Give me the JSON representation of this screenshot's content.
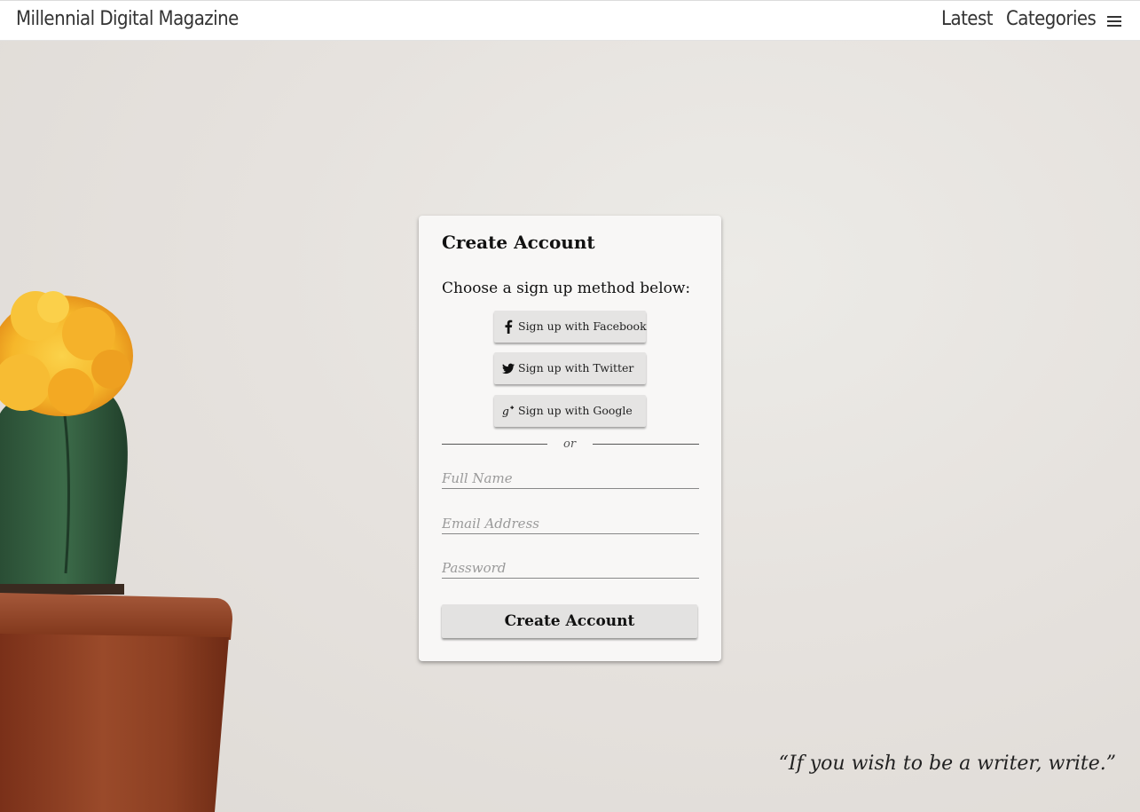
{
  "header": {
    "brand": "Millennial Digital Magazine",
    "nav": {
      "latest": "Latest",
      "categories": "Categories"
    },
    "menu_icon": "hamburger-menu-icon"
  },
  "card": {
    "title": "Create Account",
    "subtitle": "Choose a sign up method below:",
    "social": {
      "facebook": {
        "label": "Sign up with Facebook",
        "icon": "facebook-icon"
      },
      "twitter": {
        "label": "Sign up with Twitter",
        "icon": "twitter-icon"
      },
      "google": {
        "label": "Sign up with Google",
        "icon": "google-plus-icon"
      }
    },
    "divider_text": "or",
    "fields": {
      "full_name": {
        "placeholder": "Full Name",
        "value": ""
      },
      "email": {
        "placeholder": "Email Address",
        "value": ""
      },
      "password": {
        "placeholder": "Password",
        "value": ""
      }
    },
    "submit_label": "Create Account"
  },
  "quote": "“If you wish to be a writer, write.”",
  "colors": {
    "header_bg": "#ffffff",
    "page_bg": "#e9e6e2",
    "card_bg": "#f8f7f6",
    "button_bg": "#e4e3e2",
    "cactus_flower": "#f7b52c",
    "cactus_body": "#2e5a3a",
    "pot": "#8a3d22"
  }
}
